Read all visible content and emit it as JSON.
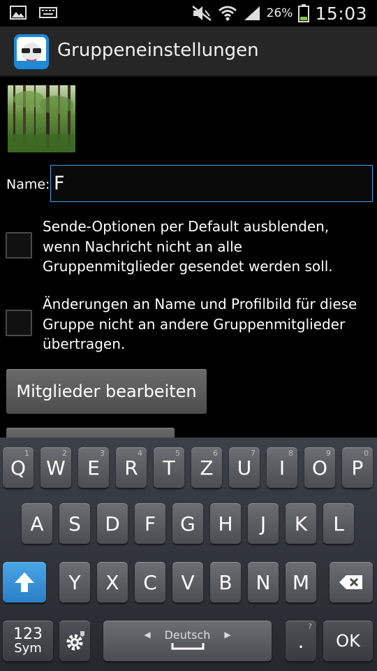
{
  "status_bar": {
    "battery_percent": "26%",
    "time": "15:03",
    "icons": [
      "image-icon",
      "keyboard-icon",
      "mute-icon",
      "wifi-icon",
      "signal-icon",
      "battery-icon"
    ]
  },
  "action_bar": {
    "title": "Gruppeneinstellungen",
    "icon": "app-logo-icon"
  },
  "form": {
    "name_label": "Name:",
    "name_value": "F",
    "option1": "Sende-Optionen per Default ausblenden, wenn Nachricht nicht an alle Gruppenmitglieder gesendet werden soll.",
    "option1_checked": false,
    "option2": "Änderungen an Name und Profilbild für diese Gruppe nicht an andere Gruppenmitglieder übertragen.",
    "option2_checked": false,
    "edit_members_button": "Mitglieder bearbeiten"
  },
  "keyboard": {
    "row1": [
      {
        "k": "Q",
        "n": "1"
      },
      {
        "k": "W",
        "n": "2"
      },
      {
        "k": "E",
        "n": "3"
      },
      {
        "k": "R",
        "n": "4"
      },
      {
        "k": "T",
        "n": "5"
      },
      {
        "k": "Z",
        "n": "6"
      },
      {
        "k": "U",
        "n": "7"
      },
      {
        "k": "I",
        "n": "8"
      },
      {
        "k": "O",
        "n": "9"
      },
      {
        "k": "P",
        "n": "0"
      }
    ],
    "row2": [
      "A",
      "S",
      "D",
      "F",
      "G",
      "H",
      "J",
      "K",
      "L"
    ],
    "row3": [
      "Y",
      "X",
      "C",
      "V",
      "B",
      "N",
      "M"
    ],
    "sym_top": "123",
    "sym_bottom": "Sym",
    "space_label": "Deutsch",
    "period": ".",
    "period_hint": "?",
    "ok": "OK"
  },
  "colors": {
    "accent": "#3fa7e6",
    "shift_key": "#3a90d6",
    "action_bar": "#262626"
  }
}
